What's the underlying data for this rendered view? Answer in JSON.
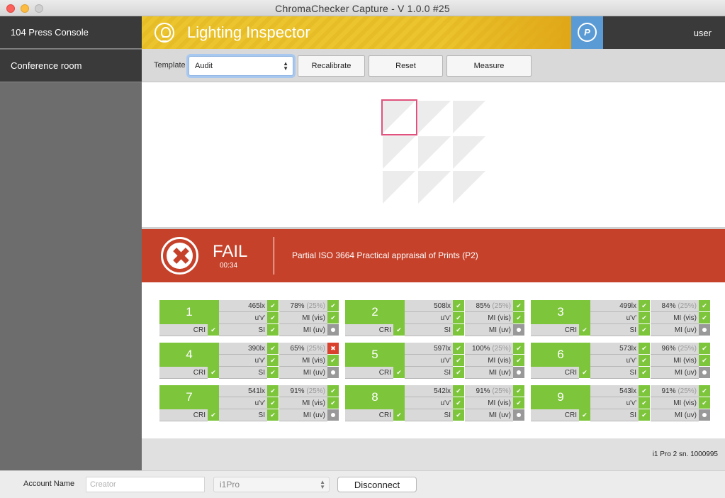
{
  "window": {
    "title": "ChromaChecker Capture  -  V 1.0.0 #25"
  },
  "sidebar": {
    "items": [
      {
        "label": "104 Press Console"
      },
      {
        "label": "Conference room"
      }
    ]
  },
  "header": {
    "title": "Lighting Inspector",
    "user": "user",
    "accent": "#ecc52e",
    "logo_icon": "p-logo-icon"
  },
  "toolbar": {
    "template_label": "Template",
    "template_value": "Audit",
    "buttons": [
      {
        "label": "Recalibrate"
      },
      {
        "label": "Reset"
      },
      {
        "label": "Measure"
      }
    ]
  },
  "result": {
    "status": "FAIL",
    "time": "00:34",
    "description": "Partial ISO 3664 Practical appraisal of Prints (P2)",
    "color": "#c5412a"
  },
  "patches": [
    {
      "num": "1",
      "lux": "465lx",
      "lux_ok": "ok",
      "pct": "78%",
      "pct_ref": "(25%)",
      "pct_ok": "ok",
      "uv": "u'v'",
      "uv_ok": "ok",
      "mivis": "MI (vis)",
      "mivis_ok": "ok",
      "cri": "CRI",
      "cri_ok": "ok",
      "si": "SI",
      "si_ok": "ok",
      "miuv": "MI (uv)",
      "miuv_ok": "neutral"
    },
    {
      "num": "2",
      "lux": "508lx",
      "lux_ok": "ok",
      "pct": "85%",
      "pct_ref": "(25%)",
      "pct_ok": "ok",
      "uv": "u'v'",
      "uv_ok": "ok",
      "mivis": "MI (vis)",
      "mivis_ok": "ok",
      "cri": "CRI",
      "cri_ok": "ok",
      "si": "SI",
      "si_ok": "ok",
      "miuv": "MI (uv)",
      "miuv_ok": "neutral"
    },
    {
      "num": "3",
      "lux": "499lx",
      "lux_ok": "ok",
      "pct": "84%",
      "pct_ref": "(25%)",
      "pct_ok": "ok",
      "uv": "u'v'",
      "uv_ok": "ok",
      "mivis": "MI (vis)",
      "mivis_ok": "ok",
      "cri": "CRI",
      "cri_ok": "ok",
      "si": "SI",
      "si_ok": "ok",
      "miuv": "MI (uv)",
      "miuv_ok": "neutral"
    },
    {
      "num": "4",
      "lux": "390lx",
      "lux_ok": "ok",
      "pct": "65%",
      "pct_ref": "(25%)",
      "pct_ok": "bad",
      "uv": "u'v'",
      "uv_ok": "ok",
      "mivis": "MI (vis)",
      "mivis_ok": "ok",
      "cri": "CRI",
      "cri_ok": "ok",
      "si": "SI",
      "si_ok": "ok",
      "miuv": "MI (uv)",
      "miuv_ok": "neutral"
    },
    {
      "num": "5",
      "lux": "597lx",
      "lux_ok": "ok",
      "pct": "100%",
      "pct_ref": "(25%)",
      "pct_ok": "ok",
      "uv": "u'v'",
      "uv_ok": "ok",
      "mivis": "MI (vis)",
      "mivis_ok": "ok",
      "cri": "CRI",
      "cri_ok": "ok",
      "si": "SI",
      "si_ok": "ok",
      "miuv": "MI (uv)",
      "miuv_ok": "neutral"
    },
    {
      "num": "6",
      "lux": "573lx",
      "lux_ok": "ok",
      "pct": "96%",
      "pct_ref": "(25%)",
      "pct_ok": "ok",
      "uv": "u'v'",
      "uv_ok": "ok",
      "mivis": "MI (vis)",
      "mivis_ok": "ok",
      "cri": "CRI",
      "cri_ok": "ok",
      "si": "SI",
      "si_ok": "ok",
      "miuv": "MI (uv)",
      "miuv_ok": "neutral"
    },
    {
      "num": "7",
      "lux": "541lx",
      "lux_ok": "ok",
      "pct": "91%",
      "pct_ref": "(25%)",
      "pct_ok": "ok",
      "uv": "u'v'",
      "uv_ok": "ok",
      "mivis": "MI (vis)",
      "mivis_ok": "ok",
      "cri": "CRI",
      "cri_ok": "ok",
      "si": "SI",
      "si_ok": "ok",
      "miuv": "MI (uv)",
      "miuv_ok": "neutral"
    },
    {
      "num": "8",
      "lux": "542lx",
      "lux_ok": "ok",
      "pct": "91%",
      "pct_ref": "(25%)",
      "pct_ok": "ok",
      "uv": "u'v'",
      "uv_ok": "ok",
      "mivis": "MI (vis)",
      "mivis_ok": "ok",
      "cri": "CRI",
      "cri_ok": "ok",
      "si": "SI",
      "si_ok": "ok",
      "miuv": "MI (uv)",
      "miuv_ok": "neutral"
    },
    {
      "num": "9",
      "lux": "543lx",
      "lux_ok": "ok",
      "pct": "91%",
      "pct_ref": "(25%)",
      "pct_ok": "ok",
      "uv": "u'v'",
      "uv_ok": "ok",
      "mivis": "MI (vis)",
      "mivis_ok": "ok",
      "cri": "CRI",
      "cri_ok": "ok",
      "si": "SI",
      "si_ok": "ok",
      "miuv": "MI (uv)",
      "miuv_ok": "neutral"
    }
  ],
  "status_bar": {
    "device_info": "i1 Pro 2 sn. 1000995"
  },
  "bottom": {
    "account_label": "Account Name",
    "account_placeholder": "Creator",
    "device_value": "i1Pro",
    "disconnect_label": "Disconnect"
  }
}
